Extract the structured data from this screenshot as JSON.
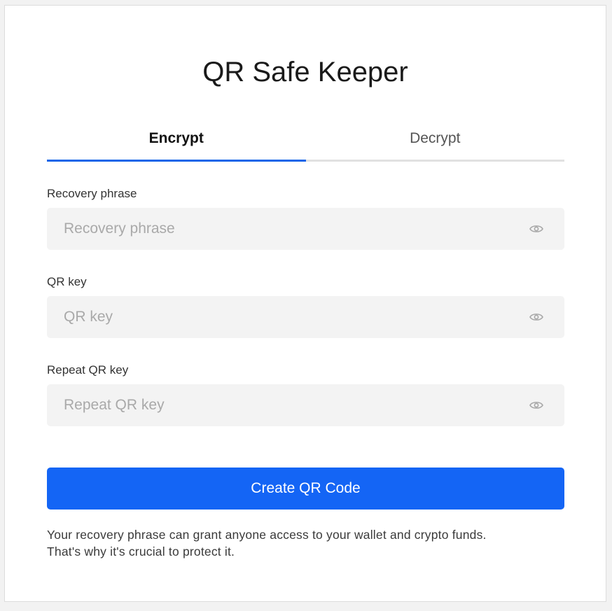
{
  "app": {
    "title": "QR Safe Keeper"
  },
  "tabs": [
    {
      "label": "Encrypt",
      "active": true
    },
    {
      "label": "Decrypt",
      "active": false
    }
  ],
  "form": {
    "fields": [
      {
        "label": "Recovery phrase",
        "placeholder": "Recovery phrase",
        "value": "",
        "icon": "eye-icon"
      },
      {
        "label": "QR key",
        "placeholder": "QR key",
        "value": "",
        "icon": "eye-icon"
      },
      {
        "label": "Repeat QR key",
        "placeholder": "Repeat QR key",
        "value": "",
        "icon": "eye-icon"
      }
    ],
    "submit_label": "Create QR Code"
  },
  "note": {
    "line1": "Your recovery phrase can grant anyone access to your wallet and crypto funds.",
    "line2": "That's why it's crucial to protect it."
  },
  "colors": {
    "accent": "#1465f5",
    "tab_underline_active": "#1465e8",
    "tab_underline_inactive": "#e1e1e1",
    "input_bg": "#f3f3f3",
    "page_bg": "#f2f2f2"
  }
}
